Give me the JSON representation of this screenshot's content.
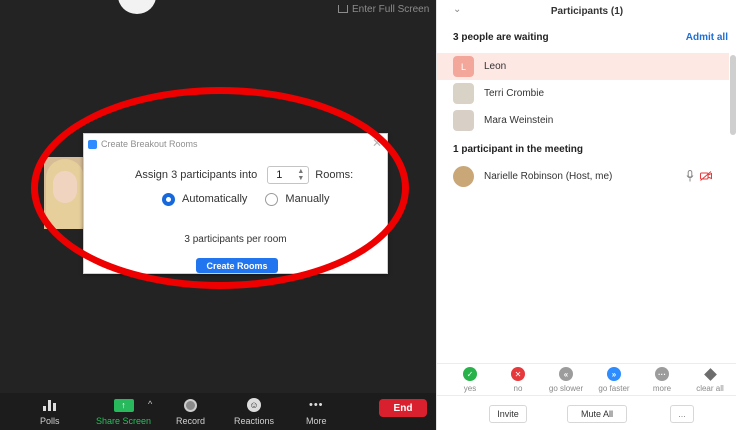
{
  "meeting": {
    "fullscreen_label": "Enter Full Screen",
    "dialog": {
      "title": "Create Breakout Rooms",
      "close_glyph": "✕",
      "assign_prefix": "Assign 3 participants into",
      "room_count": "1",
      "rooms_suffix": "Rooms:",
      "option_auto": "Automatically",
      "option_manual": "Manually",
      "selected_option": "Automatically",
      "per_room_text": "3 participants per room",
      "create_button": "Create Rooms"
    },
    "toolbar": {
      "polls": "Polls",
      "share_screen": "Share Screen",
      "record": "Record",
      "reactions": "Reactions",
      "more": "More",
      "end": "End"
    }
  },
  "panel": {
    "title": "Participants (1)",
    "waiting_title": "3 people are waiting",
    "admit_all": "Admit all",
    "waiting": [
      {
        "name": "Leon",
        "initial": "L"
      },
      {
        "name": "Terri Crombie"
      },
      {
        "name": "Mara Weinstein"
      }
    ],
    "meeting_title": "1 participant in the meeting",
    "in_meeting": [
      {
        "name": "Narielle Robinson (Host, me)"
      }
    ],
    "feedback": [
      {
        "label": "yes",
        "glyph": "✓"
      },
      {
        "label": "no",
        "glyph": "✕"
      },
      {
        "label": "go slower",
        "glyph": "«"
      },
      {
        "label": "go faster",
        "glyph": "»"
      },
      {
        "label": "more",
        "glyph": "···"
      },
      {
        "label": "clear all"
      }
    ],
    "footer": {
      "invite": "Invite",
      "mute_all": "Mute All",
      "more": "..."
    }
  },
  "icons": {
    "polls": "bar-chart-icon",
    "share": "share-screen-icon",
    "record": "record-icon",
    "reactions": "reactions-icon",
    "more": "more-dots-icon",
    "mic": "microphone-icon",
    "camera": "camera-off-icon"
  },
  "colors": {
    "accent": "#2176f0",
    "end": "#d9202e",
    "share_green": "#25c05b",
    "annotation_red": "#ee0000"
  }
}
